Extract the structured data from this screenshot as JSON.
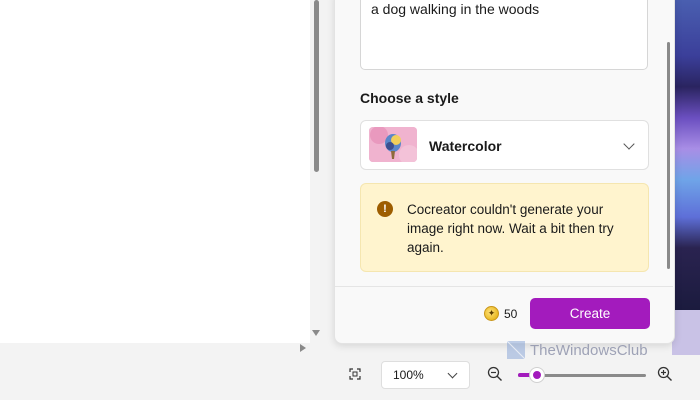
{
  "prompt": {
    "text": "a dog walking in the woods"
  },
  "style": {
    "heading": "Choose a style",
    "selected": "Watercolor"
  },
  "warning": {
    "message": "Cocreator couldn't generate your image right now. Wait a bit then try again."
  },
  "footer": {
    "credits": "50",
    "create_label": "Create"
  },
  "statusbar": {
    "zoom_value": "100%",
    "zoom_level": 0.15
  },
  "watermark": {
    "text": "TheWindowsClub"
  },
  "colors": {
    "accent": "#a31bbd",
    "warning_bg": "#fff4ce",
    "warning_icon": "#9d5d00"
  },
  "icons": [
    "warning-icon",
    "credits-icon",
    "chevron-down-icon",
    "fit-to-window-icon",
    "zoom-out-icon",
    "zoom-in-icon"
  ]
}
